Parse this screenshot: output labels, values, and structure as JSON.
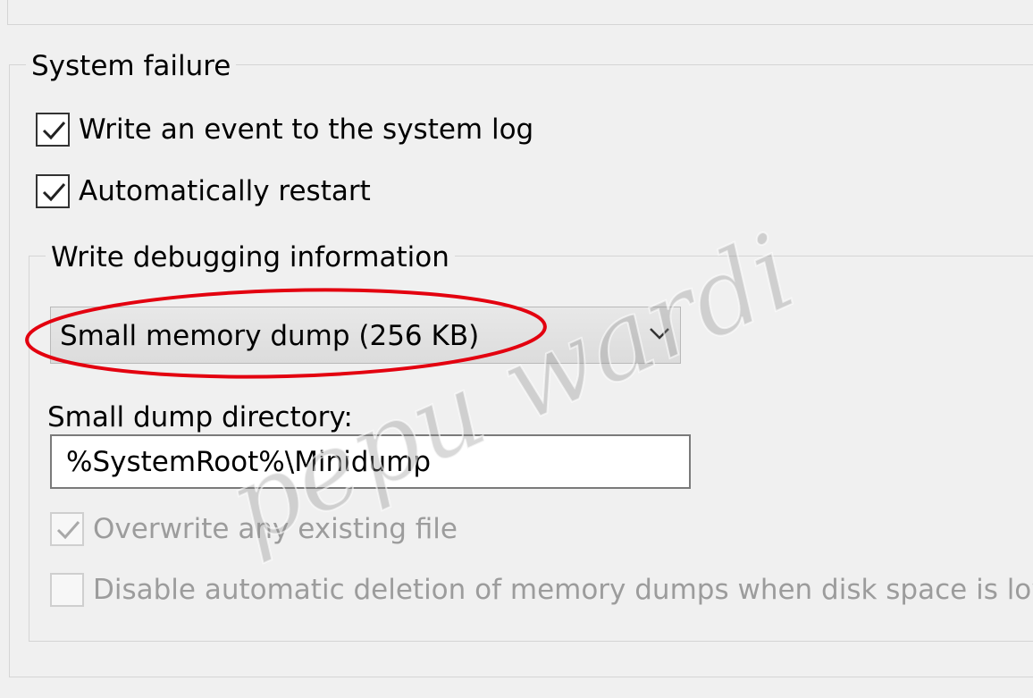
{
  "system_failure": {
    "title": "System failure",
    "write_event": {
      "label": "Write an event to the system log",
      "checked": true
    },
    "auto_restart": {
      "label": "Automatically restart",
      "checked": true
    }
  },
  "debug": {
    "title": "Write debugging information",
    "dump_type": {
      "value": "Small memory dump (256 KB)"
    },
    "directory": {
      "label": "Small dump directory:",
      "value": "%SystemRoot%\\Minidump"
    },
    "overwrite": {
      "label": "Overwrite any existing file",
      "checked": true,
      "enabled": false
    },
    "disable_auto_delete": {
      "label": "Disable automatic deletion of memory dumps when disk space is low",
      "checked": false,
      "enabled": false
    }
  },
  "annotation": {
    "highlight_color": "#e3000f",
    "watermark": "pepu wardi",
    "watermark_color": "#8a8a8a"
  }
}
